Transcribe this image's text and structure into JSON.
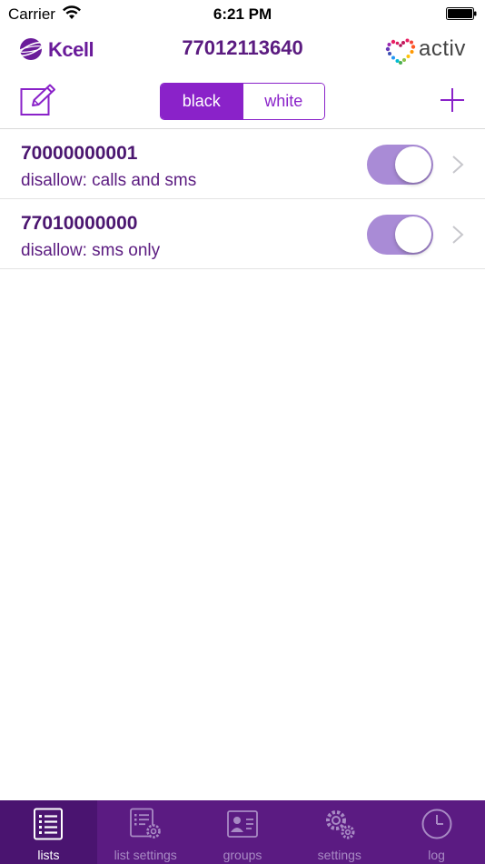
{
  "status_bar": {
    "carrier": "Carrier",
    "time": "6:21 PM"
  },
  "header": {
    "kcell_logo_text": "Kcell",
    "phone_number": "77012113640",
    "activ_logo_text": "activ"
  },
  "toolbar": {
    "segments": [
      "black",
      "white"
    ],
    "selected_segment": "black"
  },
  "list": {
    "items": [
      {
        "number": "70000000001",
        "description": "disallow: calls and sms",
        "enabled": true
      },
      {
        "number": "77010000000",
        "description": "disallow: sms only",
        "enabled": true
      }
    ]
  },
  "tabbar": {
    "tabs": [
      {
        "label": "lists",
        "icon": "list-icon",
        "active": true
      },
      {
        "label": "list settings",
        "icon": "list-settings-icon",
        "active": false
      },
      {
        "label": "groups",
        "icon": "groups-icon",
        "active": false
      },
      {
        "label": "settings",
        "icon": "gears-icon",
        "active": false
      },
      {
        "label": "log",
        "icon": "clock-icon",
        "active": false
      }
    ]
  },
  "colors": {
    "brand_purple": "#8a22c9",
    "tabbar_bg": "#5b1b82",
    "toggle_on": "#a98bd6"
  }
}
